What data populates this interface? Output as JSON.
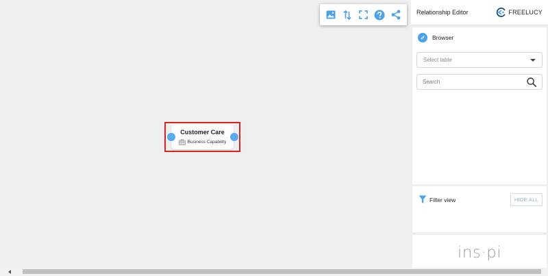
{
  "toolbar": {
    "icons": [
      "image-icon",
      "sort-arrows-icon",
      "fullscreen-icon",
      "help-icon",
      "share-icon"
    ],
    "accent": "#4aa3e8"
  },
  "node": {
    "title": "Customer Care",
    "type_label": "Business Capability",
    "selection_color": "#e02020",
    "port_color": "#5aaaf0"
  },
  "panel": {
    "title": "Relationship Editor",
    "brand": "FREELUCY",
    "browser": {
      "label": "Browser",
      "select_placeholder": "Select table",
      "search_placeholder": "Search"
    },
    "filter": {
      "label": "Filter view",
      "hide_all": "HIDE ALL"
    },
    "logo": "ins·pi"
  }
}
